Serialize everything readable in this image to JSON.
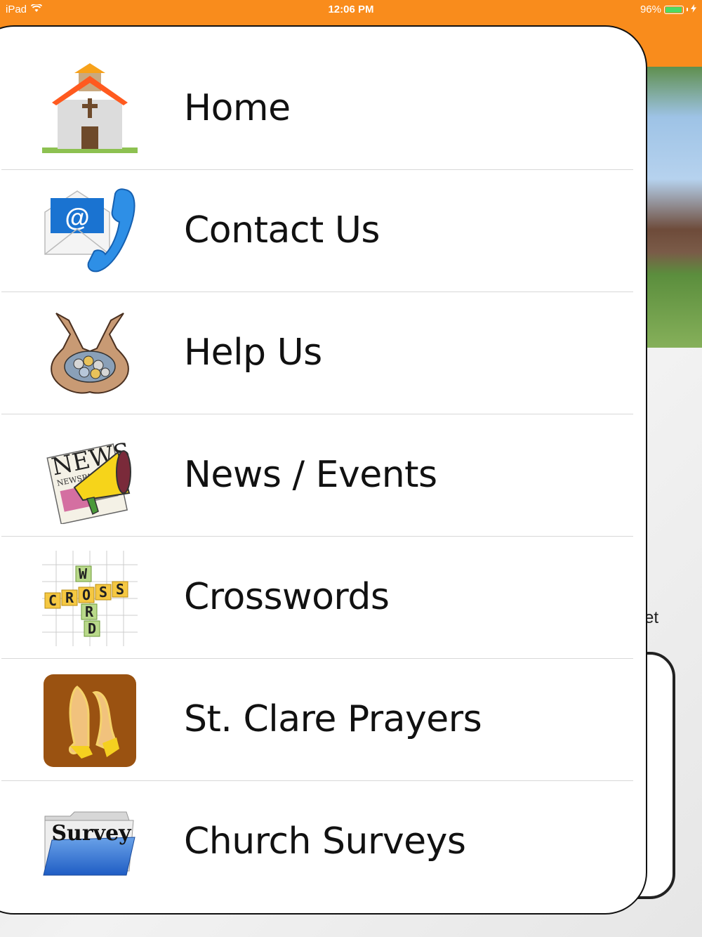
{
  "status_bar": {
    "device": "iPad",
    "time": "12:06 PM",
    "battery": "96%",
    "battery_level": 0.96
  },
  "colors": {
    "header": "#f98c1c",
    "battery_fill": "#4cd964",
    "prayers_tile": "#9a5211"
  },
  "menu": {
    "items": [
      {
        "label": "Home",
        "icon": "church-icon"
      },
      {
        "label": "Contact Us",
        "icon": "email-phone-icon"
      },
      {
        "label": "Help Us",
        "icon": "donation-hands-icon"
      },
      {
        "label": "News / Events",
        "icon": "news-megaphone-icon"
      },
      {
        "label": "Crosswords",
        "icon": "crossword-icon"
      },
      {
        "label": "St. Clare Prayers",
        "icon": "praying-hands-icon"
      },
      {
        "label": "Church Surveys",
        "icon": "survey-folder-icon"
      }
    ]
  },
  "background": {
    "partial_text": "et"
  },
  "icon_text": {
    "news": "NEWS",
    "newspaper": "NEWSPAPER",
    "survey": "Survey",
    "cross_letters": [
      "C",
      "R",
      "O",
      "S",
      "S"
    ],
    "word_letters": [
      "W",
      "O",
      "R",
      "D"
    ]
  }
}
